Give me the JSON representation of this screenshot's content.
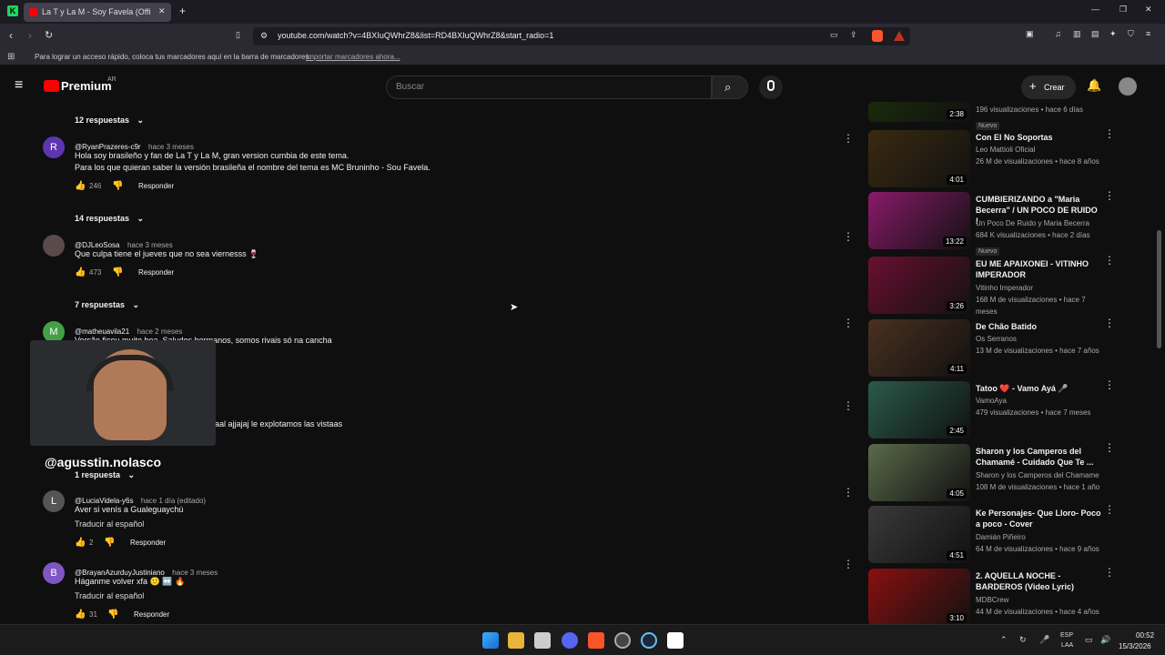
{
  "browser": {
    "tab_title": "La T y La M - Soy Favela (Offi",
    "url": "youtube.com/watch?v=4BXIuQWhrZ8&list=RD4BXIuQWhrZ8&start_radio=1",
    "bookmarks_text": "Para lograr un acceso rápido, coloca tus marcadores aquí en la barra de marcadores.",
    "bookmarks_link": "Importar marcadores ahora..."
  },
  "youtube": {
    "logo_text": "Premium",
    "logo_region": "AR",
    "search_placeholder": "Buscar",
    "create_label": "Crear"
  },
  "comments": [
    {
      "replies": "12 respuestas"
    },
    {
      "initial": "R",
      "author": "@RyanPrazeres-c9r",
      "time": "hace 3 meses",
      "text1": "Hola soy brasileño y fan de La T y La M, gran version cumbia de este tema.",
      "text2": "Para los que quieran saber la versión brasileña el nombre del tema es MC Bruninho - Sou Favela.",
      "likes": "246",
      "reply": "Responder",
      "replies": "14 respuestas"
    },
    {
      "initial": "",
      "author": "@DJLeoSosa",
      "time": "hace 3 meses",
      "text1": "Que culpa tiene el jueves que no sea viernesss 🍷",
      "likes": "473",
      "reply": "Responder",
      "replies": "7 respuestas"
    },
    {
      "initial": "M",
      "author": "@matheuavila21",
      "time": "hace 2 meses",
      "text1": "Versão ficou muito boa. Saludos hermanos, somos rivais só na cancha",
      "text_partial": "aal ajjajaj le explotamos las vistaas",
      "replies": "1 respuesta"
    },
    {
      "initial": "L",
      "author": "@LuciaVidela-y6s",
      "time": "hace 1 día (editado)",
      "text1": "Aver si venís a Gualeguaychú",
      "translate": "Traducir al español",
      "likes": "2",
      "reply": "Responder"
    },
    {
      "initial": "B",
      "author": "@BrayanAzurduyJustiniano",
      "time": "hace 3 meses",
      "text1": "Háganme volver xfa 🙂 ↔️ 🔥",
      "translate": "Traducir al español",
      "likes": "31",
      "reply": "Responder"
    }
  ],
  "overlay": {
    "streamer_handle": "@agusstin.nolasco"
  },
  "playlist": [
    {
      "title": "",
      "channel": "",
      "views": "196 visualizaciones • hace 6 días",
      "duration": "2:38",
      "badge": "Nuevo",
      "color": "#1a2a0a"
    },
    {
      "title": "Con El No Soportas",
      "channel": "Leo Mattioli Oficial",
      "views": "26 M de visualizaciones • hace 8 años",
      "duration": "4:01",
      "color": "#3a2a10"
    },
    {
      "title": "CUMBIERIZANDO a \"Maria Becerra\" / UN POCO DE RUIDO !",
      "channel": "Un Poco De Ruido  y Maria Becerra",
      "views": "684 K visualizaciones • hace 2 días",
      "duration": "13:22",
      "badge": "Nuevo",
      "color": "#8a1a6a"
    },
    {
      "title": "EU ME APAIXONEI - VITINHO IMPERADOR",
      "channel": "Vitinho Imperador",
      "views": "168 M de visualizaciones • hace 7 meses",
      "duration": "3:26",
      "color": "#6a1030"
    },
    {
      "title": "De Chão Batido",
      "channel": "Os Serranos",
      "views": "13 M de visualizaciones • hace 7 años",
      "duration": "4:11",
      "color": "#4a3020"
    },
    {
      "title": "Tatoo ❤️ - Vamo Ayá 🎤",
      "channel": "VamoAya",
      "views": "479 visualizaciones • hace 7 meses",
      "duration": "2:45",
      "color": "#2a5a4a"
    },
    {
      "title": "Sharon y los Camperos del Chamamé - Cuidado Que Te ...",
      "channel": "Sharon y los Camperos del Chamame",
      "views": "108 M de visualizaciones • hace 1 año",
      "duration": "4:05",
      "color": "#5a6a4a"
    },
    {
      "title": "Ke Personajes- Que Lloro- Poco a poco - Cover",
      "channel": "Damián Piñeiro",
      "views": "64 M de visualizaciones • hace 9 años",
      "duration": "4:51",
      "color": "#3a3a3a"
    },
    {
      "title": "2. AQUELLA NOCHE - BARDEROS (Video Lyric)",
      "channel": "MDBCrew",
      "views": "44 M de visualizaciones • hace 4 años",
      "duration": "3:10",
      "color": "#8a1010"
    }
  ],
  "taskbar": {
    "lang1": "ESP",
    "lang2": "LAA",
    "time": "00:52",
    "date": "15/3/2026"
  }
}
